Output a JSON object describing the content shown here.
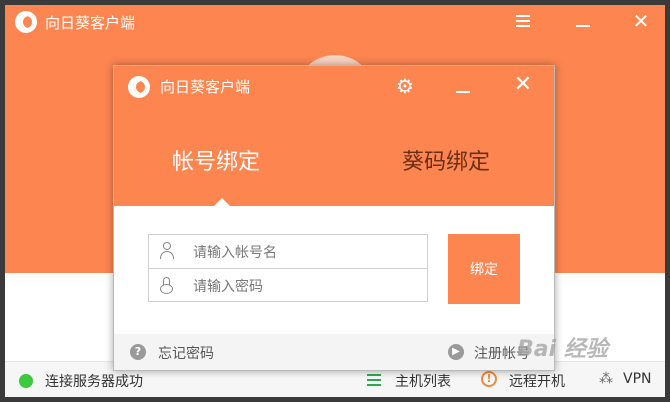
{
  "app": {
    "title": "向日葵客户端"
  },
  "main_window": {
    "status_text": "连接服务器成功",
    "host_list_label": "主机列表",
    "wake_label": "远程开机",
    "vpn_label": "VPN"
  },
  "dialog": {
    "title": "向日葵客户端",
    "tabs": [
      {
        "label": "帐号绑定",
        "active": true
      },
      {
        "label": "葵码绑定",
        "active": false
      }
    ],
    "account_placeholder": "请输入帐号名",
    "password_placeholder": "请输入密码",
    "bind_label": "绑定",
    "forgot_label": "忘记密码",
    "register_label": "注册帐号"
  },
  "watermark": {
    "text": "Bai 经验"
  },
  "colors": {
    "accent": "#fd8550",
    "status_ok": "#3cc93c",
    "warning": "#f08a3a"
  },
  "icons": [
    "logo-icon",
    "menu-icon",
    "minimize-icon",
    "close-icon",
    "gear-icon",
    "user-icon",
    "lock-icon",
    "help-icon",
    "arrow-right-icon",
    "list-icon",
    "warning-icon",
    "vpn-icon"
  ]
}
